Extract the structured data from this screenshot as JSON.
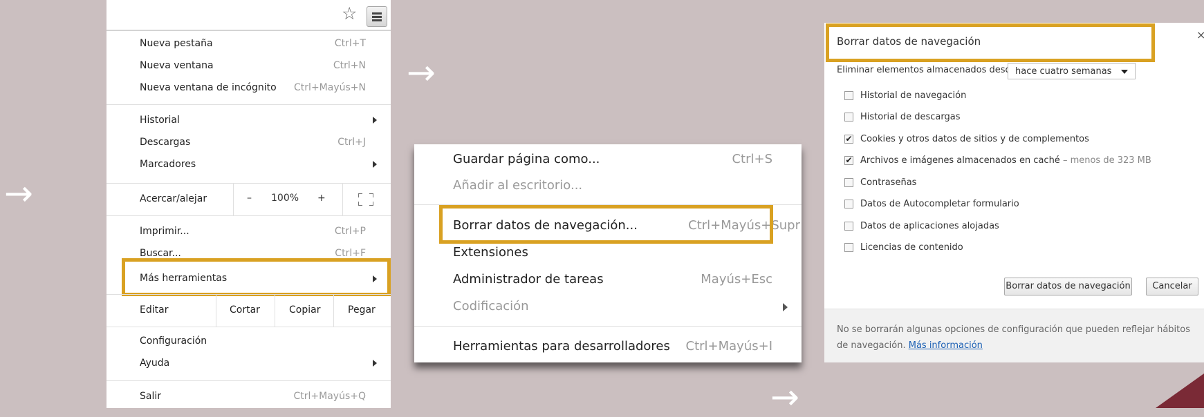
{
  "chrome_menu": {
    "items_group1": [
      {
        "label": "Nueva pestaña",
        "shortcut": "Ctrl+T"
      },
      {
        "label": "Nueva ventana",
        "shortcut": "Ctrl+N"
      },
      {
        "label": "Nueva ventana de incógnito",
        "shortcut": "Ctrl+Mayús+N"
      }
    ],
    "items_group2": [
      {
        "label": "Historial"
      },
      {
        "label": "Descargas",
        "shortcut": "Ctrl+J"
      },
      {
        "label": "Marcadores"
      }
    ],
    "zoom": {
      "label": "Acercar/alejar",
      "minus": "–",
      "value": "100%",
      "plus": "+"
    },
    "items_group3": [
      {
        "label": "Imprimir...",
        "shortcut": "Ctrl+P"
      },
      {
        "label": "Buscar...",
        "shortcut": "Ctrl+F"
      },
      {
        "label": "Más herramientas"
      }
    ],
    "edit": {
      "label": "Editar",
      "cut": "Cortar",
      "copy": "Copiar",
      "paste": "Pegar"
    },
    "items_group4": [
      {
        "label": "Configuración"
      },
      {
        "label": "Ayuda"
      }
    ],
    "exit": {
      "label": "Salir",
      "shortcut": "Ctrl+Mayús+Q"
    }
  },
  "more_tools": {
    "items": [
      {
        "label": "Guardar página como...",
        "shortcut": "Ctrl+S"
      },
      {
        "label": "Añadir al escritorio..."
      },
      {
        "label": "Borrar datos de navegación...",
        "shortcut": "Ctrl+Mayús+Supr"
      },
      {
        "label": "Extensiones"
      },
      {
        "label": "Administrador de tareas",
        "shortcut": "Mayús+Esc"
      },
      {
        "label": "Codificación"
      },
      {
        "label": "Herramientas para desarrolladores",
        "shortcut": "Ctrl+Mayús+I"
      }
    ]
  },
  "dialog": {
    "title": "Borrar datos de navegación",
    "close": "×",
    "remove_label": "Eliminar elementos almacenados desde:",
    "period_selected": "hace cuatro semanas",
    "checkboxes": [
      {
        "label": "Historial de navegación",
        "checked": false
      },
      {
        "label": "Historial de descargas",
        "checked": false
      },
      {
        "label": "Cookies y otros datos de sitios y de complementos",
        "checked": true
      },
      {
        "label": "Archivos e imágenes almacenados en caché",
        "extra": " – menos de 323 MB",
        "checked": true
      },
      {
        "label": "Contraseñas",
        "checked": false
      },
      {
        "label": "Datos de Autocompletar formulario",
        "checked": false
      },
      {
        "label": "Datos de aplicaciones alojadas",
        "checked": false
      },
      {
        "label": "Licencias de contenido",
        "checked": false
      }
    ],
    "confirm_button": "Borrar datos de navegación",
    "cancel_button": "Cancelar",
    "footer_text": "No se borrarán algunas opciones de configuración que pueden reflejar hábitos de navegación.",
    "footer_link": "Más información"
  },
  "colors": {
    "background": "#cbbfc0",
    "highlight": "#d9a122",
    "arrow": "#ffffff",
    "corner_accent": "#7a2a36"
  },
  "icons": {
    "arrow": "→",
    "star": "☆",
    "check": "✔"
  }
}
